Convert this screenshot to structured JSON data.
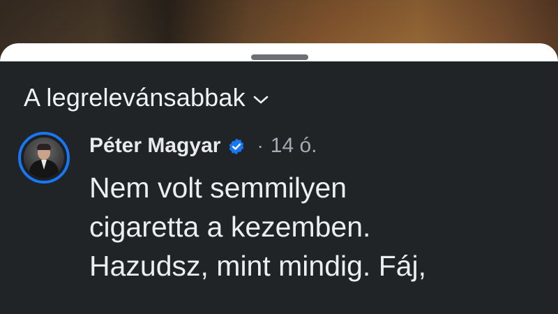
{
  "sort": {
    "label": "A legrelevánsabbak",
    "icon": "chevron-down-icon"
  },
  "comment": {
    "author": "Péter Magyar",
    "verified_icon": "verified-badge-icon",
    "separator": "·",
    "time": "14 ó.",
    "lines": [
      "Nem volt semmilyen",
      "cigaretta a kezemben.",
      "Hazudsz, mint mindig. Fáj,"
    ]
  },
  "colors": {
    "accent": "#1877f2",
    "sheet_bg": "#212427",
    "text": "#eceef0",
    "muted": "#a8abb0"
  }
}
